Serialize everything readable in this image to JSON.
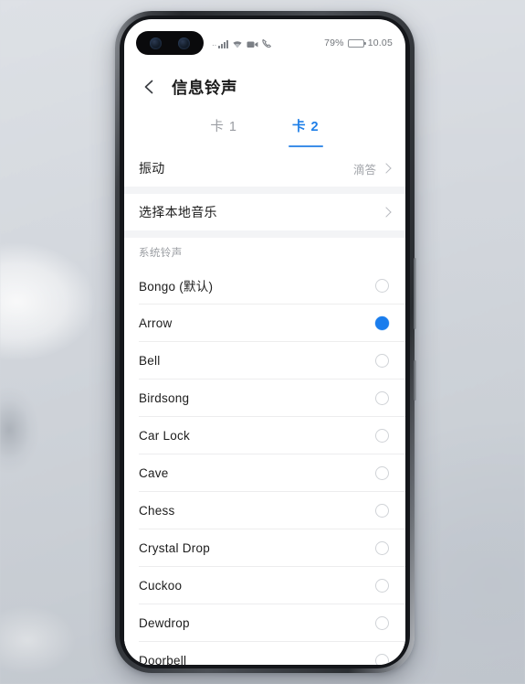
{
  "status_bar": {
    "signal_icon": "signal-bars-icon",
    "wifi_icon": "wifi-icon",
    "video_call_icon": "video-call-icon",
    "call_icon": "phone-call-icon",
    "battery_percent": "79%",
    "battery_icon": "battery-icon",
    "time": "10.05"
  },
  "app_bar": {
    "back_icon": "back-arrow-icon",
    "title": "信息铃声"
  },
  "tabs": [
    {
      "label": "卡 1",
      "active": false
    },
    {
      "label": "卡 2",
      "active": true
    }
  ],
  "settings_rows": [
    {
      "label": "振动",
      "value": "滴答",
      "chevron": true
    },
    {
      "label": "选择本地音乐",
      "value": "",
      "chevron": true
    }
  ],
  "section": {
    "header": "系统铃声"
  },
  "ringtones": [
    {
      "label": "Bongo (默认)",
      "selected": false
    },
    {
      "label": "Arrow",
      "selected": true
    },
    {
      "label": "Bell",
      "selected": false
    },
    {
      "label": "Birdsong",
      "selected": false
    },
    {
      "label": "Car Lock",
      "selected": false
    },
    {
      "label": "Cave",
      "selected": false
    },
    {
      "label": "Chess",
      "selected": false
    },
    {
      "label": "Crystal Drop",
      "selected": false
    },
    {
      "label": "Cuckoo",
      "selected": false
    },
    {
      "label": "Dewdrop",
      "selected": false
    },
    {
      "label": "Doorbell",
      "selected": false
    }
  ],
  "pointer": {
    "cursor_icon": "red-arrow-cursor-icon",
    "tap_icon": "tap-highlight-icon"
  },
  "colors": {
    "accent_blue": "#1a7ded",
    "tab_active": "#1f7fe8",
    "cursor_red": "#ee1c1c",
    "backdrop": "#d6dadf"
  },
  "device": {
    "camera_cutout": "dual-punch-hole-camera",
    "volume_button": "volume-button",
    "power_button": "power-button"
  }
}
